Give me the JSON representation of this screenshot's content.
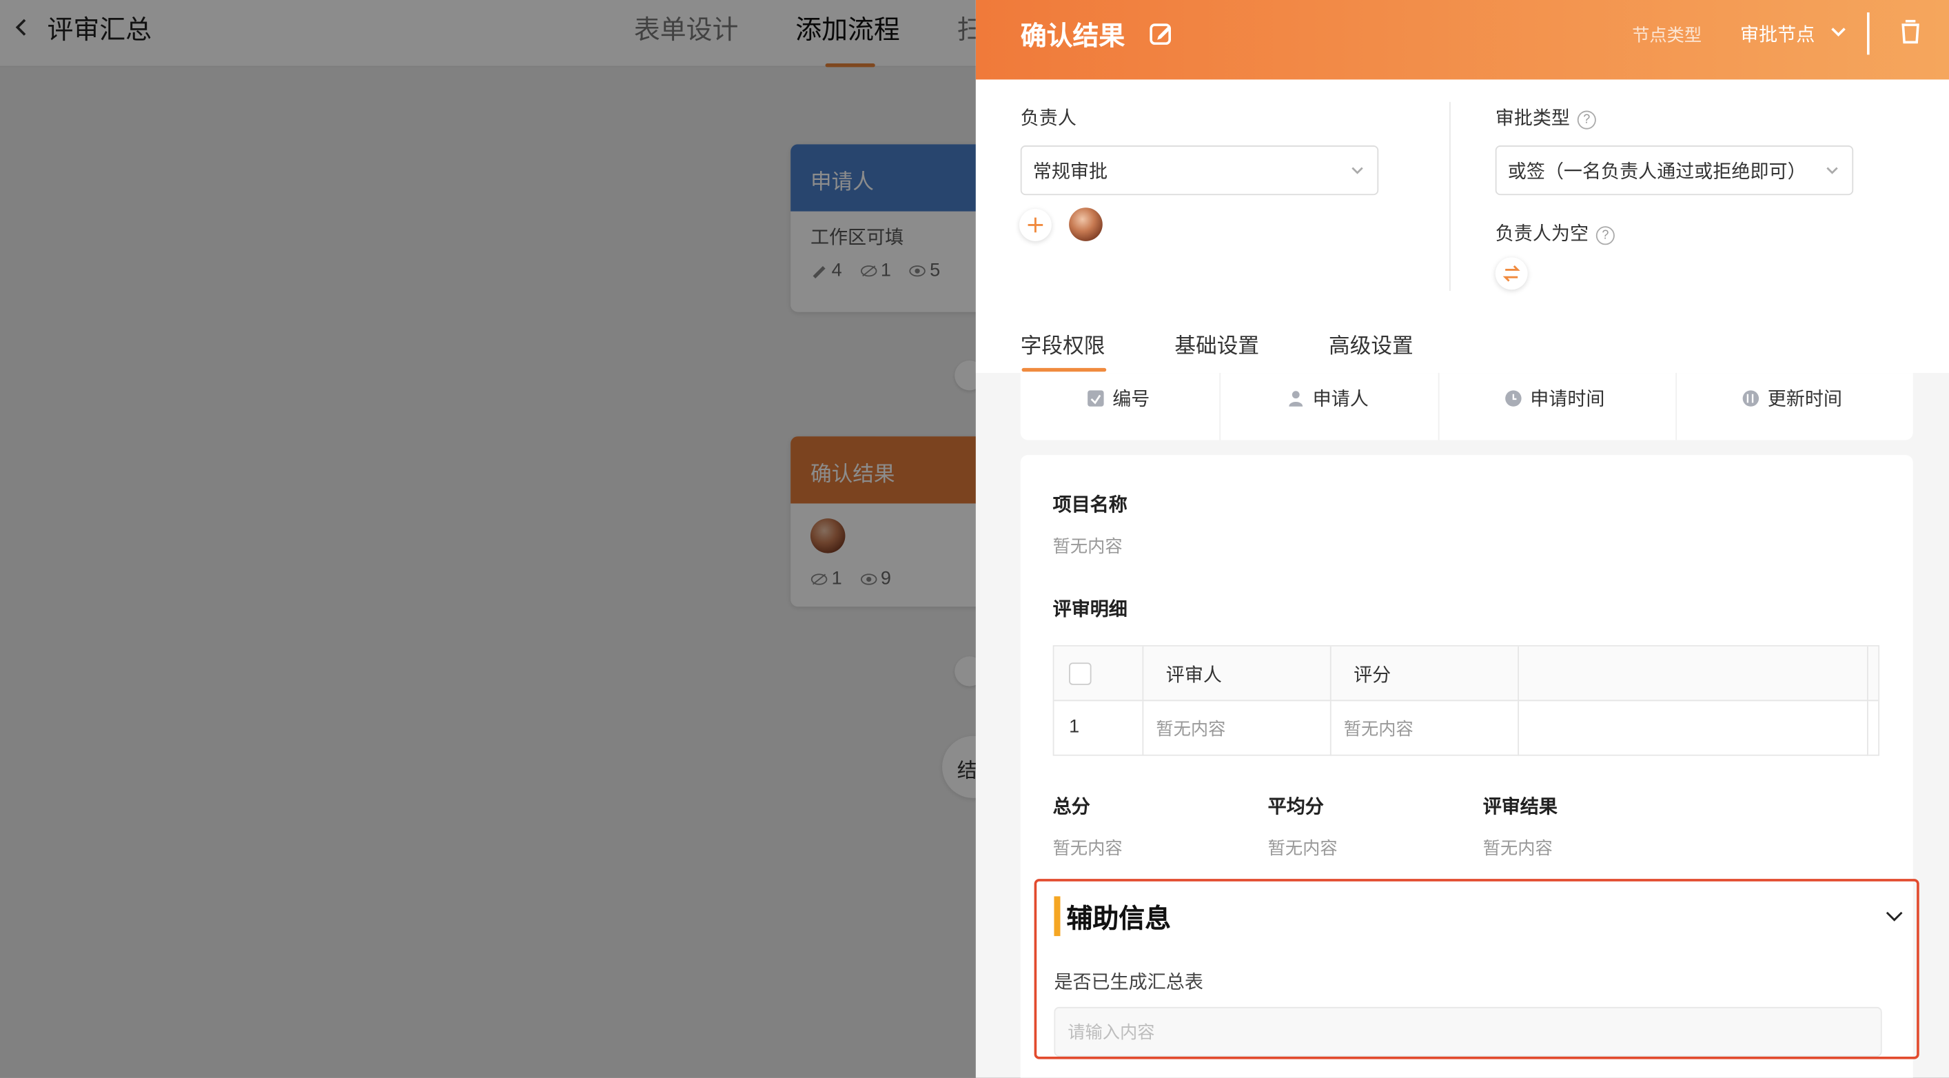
{
  "header": {
    "back_label": "评审汇总",
    "tabs": [
      {
        "label": "表单设计"
      },
      {
        "label": "添加流程"
      },
      {
        "label": "扫"
      }
    ]
  },
  "flow": {
    "applicant_node": {
      "title": "申请人",
      "subtitle": "工作区可填",
      "stats": {
        "edit": "4",
        "hidden": "1",
        "view": "5"
      }
    },
    "confirm_node": {
      "title": "确认结果",
      "stats": {
        "hidden": "1",
        "view": "9"
      }
    },
    "end_node": {
      "label": "结"
    }
  },
  "drawer": {
    "title": "确认结果",
    "node_type_label": "节点类型",
    "node_type_value": "审批节点",
    "owner_label": "负责人",
    "owner_select": "常规审批",
    "approval_type_label": "审批类型",
    "approval_type_value": "或签（一名负责人通过或拒绝即可）",
    "owner_empty_label": "负责人为空",
    "tabs": [
      {
        "label": "字段权限"
      },
      {
        "label": "基础设置"
      },
      {
        "label": "高级设置"
      }
    ],
    "system_fields": [
      {
        "label": "编号",
        "icon": "id-icon"
      },
      {
        "label": "申请人",
        "icon": "person-icon"
      },
      {
        "label": "申请时间",
        "icon": "clock-icon"
      },
      {
        "label": "更新时间",
        "icon": "update-icon"
      }
    ],
    "form": {
      "project_name_label": "项目名称",
      "project_name_value": "暂无内容",
      "detail_label": "评审明细",
      "table": {
        "headers": [
          "评审人",
          "评分"
        ],
        "rows": [
          {
            "index": "1",
            "reviewer": "暂无内容",
            "score": "暂无内容"
          }
        ]
      },
      "summary": [
        {
          "label": "总分",
          "value": "暂无内容"
        },
        {
          "label": "平均分",
          "value": "暂无内容"
        },
        {
          "label": "评审结果",
          "value": "暂无内容"
        }
      ]
    },
    "aux": {
      "title": "辅助信息",
      "field_label": "是否已生成汇总表",
      "input_placeholder": "请输入内容"
    }
  },
  "colors": {
    "accent": "#f08a3e",
    "applicant_node": "#4a7fc9",
    "confirm_node": "#e07a3a",
    "highlight_border": "#e24b2e"
  }
}
